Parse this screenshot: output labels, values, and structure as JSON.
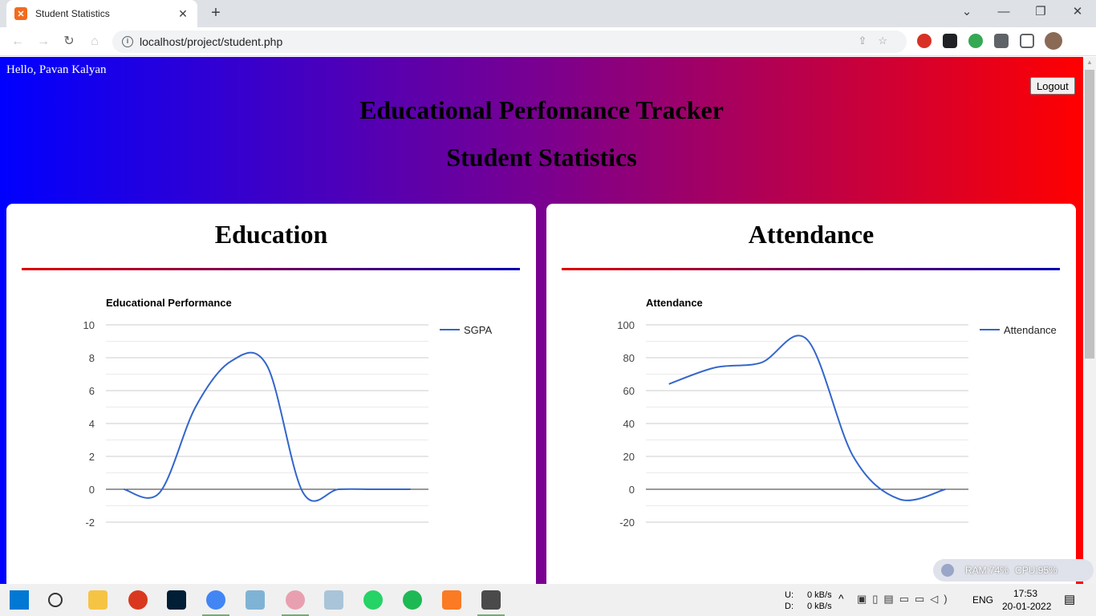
{
  "browser": {
    "tab_title": "Student Statistics",
    "tab_favicon_letter": "✕",
    "url": "localhost/project/student.php"
  },
  "page": {
    "greeting": "Hello, Pavan Kalyan",
    "logout_label": "Logout",
    "title": "Educational Perfomance Tracker",
    "subtitle": "Student Statistics"
  },
  "cards": {
    "education": {
      "heading": "Education"
    },
    "attendance": {
      "heading": "Attendance"
    }
  },
  "chart_data": [
    {
      "type": "line",
      "title": "Educational Performance",
      "series": [
        {
          "name": "SGPA",
          "color": "#3366cc",
          "values": [
            0,
            -0.2,
            5,
            7.8,
            7.5,
            -0.2,
            0,
            0,
            0
          ]
        }
      ],
      "x": [
        0,
        1,
        2,
        3,
        4,
        5,
        6,
        7,
        8
      ],
      "ylim": [
        -2,
        10
      ],
      "yticks": [
        -2,
        0,
        2,
        4,
        6,
        8,
        10
      ],
      "legend": "right",
      "grid": true
    },
    {
      "type": "line",
      "title": "Attendance",
      "series": [
        {
          "name": "Attendance",
          "color": "#3366cc",
          "values": [
            64,
            74,
            77,
            91,
            20,
            -6,
            0
          ]
        }
      ],
      "x": [
        0,
        1,
        2,
        3,
        4,
        5,
        6
      ],
      "ylim": [
        -20,
        100
      ],
      "yticks": [
        -20,
        0,
        20,
        40,
        60,
        80,
        100
      ],
      "legend": "right",
      "grid": true
    }
  ],
  "perf_widget": {
    "ram": "RAM:74%",
    "cpu": "CPU:95%"
  },
  "tray": {
    "upload_label": "U:",
    "download_label": "D:",
    "upload_rate": "0 kB/s",
    "download_rate": "0 kB/s",
    "language": "ENG",
    "time": "17:53",
    "date": "20-01-2022"
  }
}
